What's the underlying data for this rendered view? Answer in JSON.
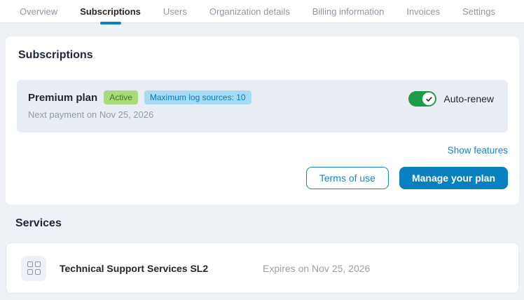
{
  "tabs": {
    "items": [
      {
        "label": "Overview",
        "active": false
      },
      {
        "label": "Subscriptions",
        "active": true
      },
      {
        "label": "Users",
        "active": false
      },
      {
        "label": "Organization details",
        "active": false
      },
      {
        "label": "Billing information",
        "active": false
      },
      {
        "label": "Invoices",
        "active": false
      },
      {
        "label": "Settings",
        "active": false
      }
    ]
  },
  "subscriptions": {
    "heading": "Subscriptions",
    "plan": {
      "name": "Premium plan",
      "status_badge": "Active",
      "limit_badge": "Maximum log sources: 10",
      "next_payment": "Next payment on Nov 25, 2026",
      "auto_renew_label": "Auto-renew",
      "auto_renew_on": true
    },
    "show_features_link": "Show features",
    "terms_button": "Terms of use",
    "manage_button": "Manage your plan"
  },
  "services": {
    "heading": "Services",
    "items": [
      {
        "name": "Technical Support Services SL2",
        "expires": "Expires on Nov 25, 2026"
      }
    ]
  },
  "colors": {
    "accent_blue": "#0b80c1",
    "link_blue": "#1b85c4",
    "tab_underline": "#0e82c5",
    "toggle_green": "#1f9c49",
    "badge_green_bg": "#a9db7d",
    "badge_green_text": "#41741a",
    "badge_blue_bg": "#a6daf5",
    "badge_blue_text": "#0f79b7",
    "page_bg": "#eef2f6",
    "panel_bg": "#e9eef5",
    "heading_text": "#1d2736",
    "muted_text": "#8f98a3"
  }
}
